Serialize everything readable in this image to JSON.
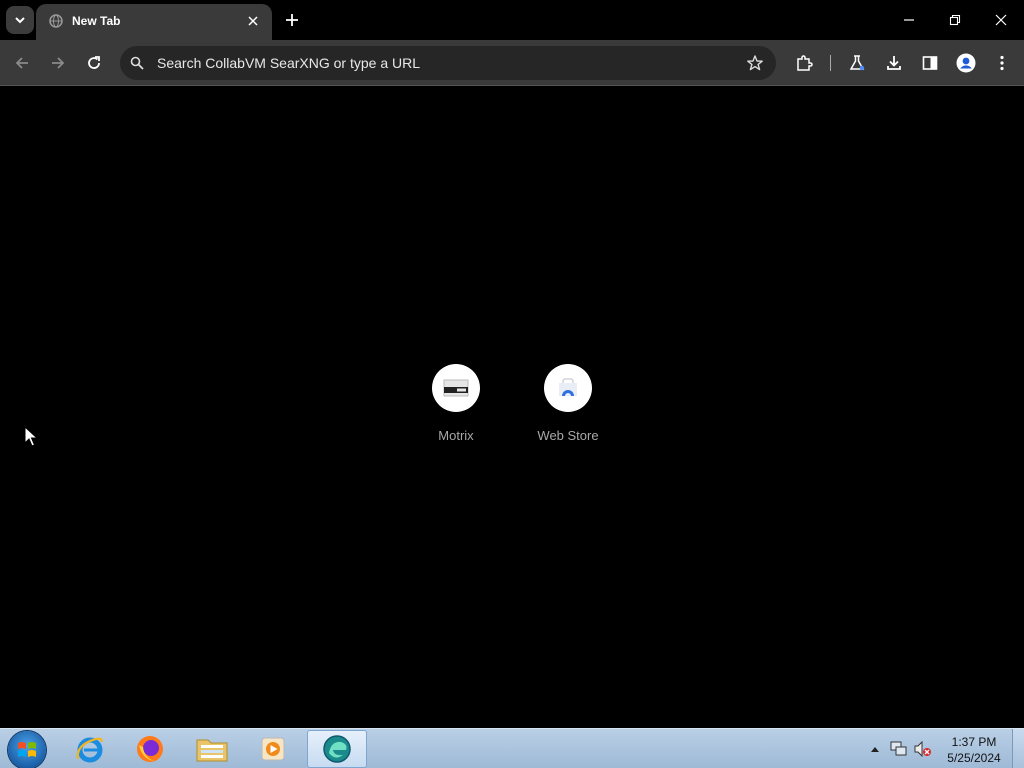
{
  "browser": {
    "tab": {
      "title": "New Tab"
    },
    "omnibox": {
      "placeholder": "Search CollabVM SearXNG or type a URL"
    }
  },
  "new_tab_page": {
    "shortcuts": [
      {
        "label": "Motrix"
      },
      {
        "label": "Web Store"
      }
    ]
  },
  "taskbar": {
    "apps": [
      "internet-explorer",
      "firefox",
      "file-explorer",
      "media-player",
      "edge"
    ],
    "clock": {
      "time": "1:37 PM",
      "date": "5/25/2024"
    }
  },
  "colors": {
    "page_background": "#000000",
    "toolbar": "#3a3a3a",
    "taskbar": "#a9c2dd"
  }
}
